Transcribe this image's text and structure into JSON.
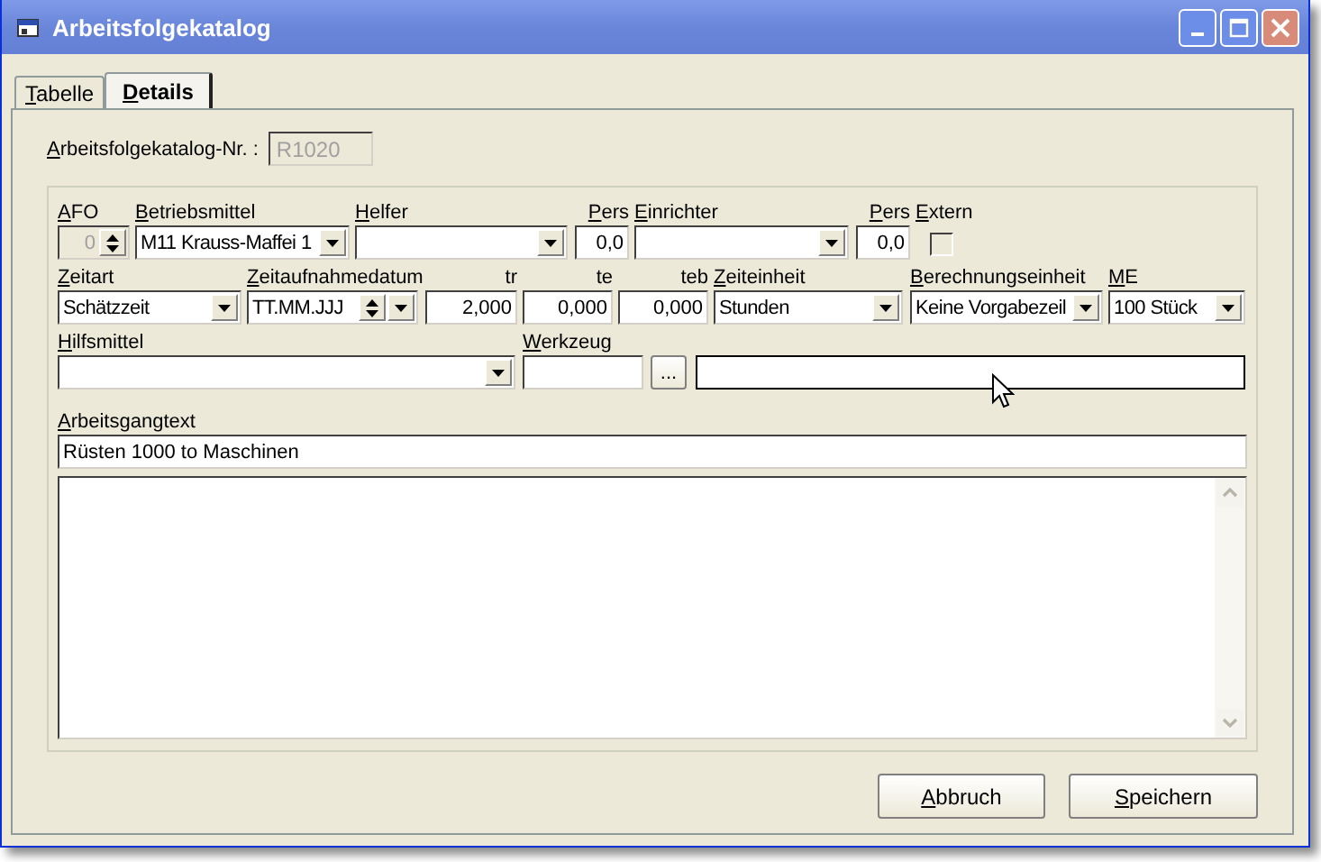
{
  "window": {
    "title": "Arbeitsfolgekatalog"
  },
  "tabs": [
    {
      "label": "Tabelle",
      "mnemonic": true,
      "selected": false
    },
    {
      "label": "Details",
      "mnemonic": true,
      "selected": true
    }
  ],
  "catalog_number": {
    "label": "Arbeitsfolgekatalog-Nr. :",
    "mnemonic": true,
    "value": "R1020",
    "disabled": true
  },
  "rows": [
    [
      {
        "kind": "spin",
        "label": "AFO",
        "mnemonic": true,
        "value": "0",
        "disabled": true
      },
      {
        "kind": "combo",
        "label": "Betriebsmittel",
        "mnemonic": true,
        "value": "M11 Krauss-Maffei 1"
      },
      {
        "kind": "combo",
        "label": "Helfer",
        "mnemonic": true
      },
      {
        "kind": "number",
        "label": "Pers",
        "mnemonic": true,
        "value": "0,0"
      },
      {
        "kind": "combo",
        "label": "Einrichter",
        "mnemonic": true
      },
      {
        "kind": "number",
        "label": "Pers",
        "mnemonic": true,
        "value": "0,0"
      },
      {
        "kind": "checkbox",
        "label": "Extern",
        "mnemonic": true,
        "checked": false
      }
    ],
    [
      {
        "kind": "combo",
        "label": "Zeitart",
        "mnemonic": true,
        "value": "Schätzzeit"
      },
      {
        "kind": "date",
        "label": "Zeitaufnahmedatum",
        "mnemonic": true,
        "value": "TT.MM.JJJ"
      },
      {
        "kind": "number",
        "label": "tr",
        "mnemonic": false,
        "value": "2,000"
      },
      {
        "kind": "number",
        "label": "te",
        "mnemonic": false,
        "value": "0,000"
      },
      {
        "kind": "number",
        "label": "teb",
        "mnemonic": false,
        "value": "0,000"
      },
      {
        "kind": "combo",
        "label": "Zeiteinheit",
        "mnemonic": true,
        "value": "Stunden"
      },
      {
        "kind": "combo",
        "label": "Berechnungseinheit",
        "mnemonic": true,
        "value": "Keine Vorgabezeil"
      },
      {
        "kind": "combo",
        "label": "ME",
        "mnemonic": true,
        "value": "100 Stück"
      }
    ],
    [
      {
        "kind": "combo",
        "label": "Hilfsmittel",
        "mnemonic": true
      },
      {
        "kind": "text",
        "label": "Werkzeug",
        "mnemonic": true
      },
      {
        "kind": "button",
        "value": "..."
      },
      {
        "kind": "text"
      }
    ]
  ],
  "operation_text": {
    "label": "Arbeitsgangtext",
    "mnemonic": true,
    "value": "Rüsten 1000 to Maschinen"
  },
  "buttons": [
    {
      "label": "Abbruch",
      "mnemonic": true
    },
    {
      "label": "Speichern",
      "mnemonic": true
    }
  ]
}
